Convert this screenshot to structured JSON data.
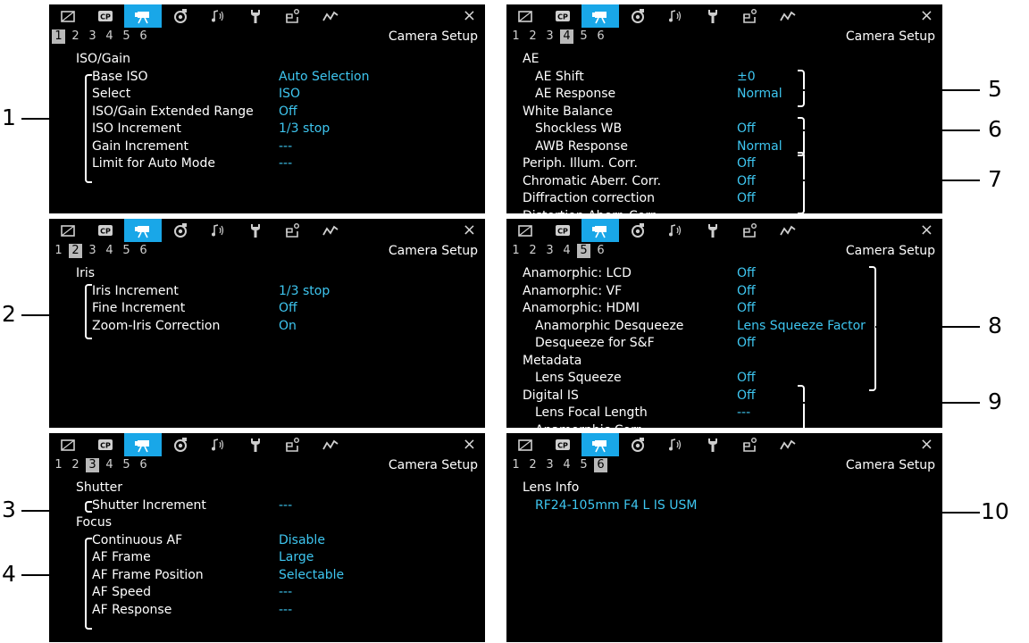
{
  "tabs": [
    {
      "icon": "screen-icon"
    },
    {
      "icon": "cp-icon"
    },
    {
      "icon": "camera-icon"
    },
    {
      "icon": "aperture-icon"
    },
    {
      "icon": "audio-icon"
    },
    {
      "icon": "wrench-icon"
    },
    {
      "icon": "assist-icon"
    },
    {
      "icon": "waveform-icon"
    }
  ],
  "close_glyph": "×",
  "panel_title": "Camera Setup",
  "page_numbers": [
    "1",
    "2",
    "3",
    "4",
    "5",
    "6"
  ],
  "panels": [
    {
      "active_page": 0,
      "rows": [
        {
          "label": "ISO/Gain",
          "value": "",
          "indent": 0
        },
        {
          "label": "Base ISO",
          "value": "Auto Selection",
          "indent": 1
        },
        {
          "label": "Select",
          "value": "ISO",
          "indent": 1
        },
        {
          "label": "ISO/Gain Extended Range",
          "value": "Off",
          "indent": 1
        },
        {
          "label": "ISO Increment",
          "value": "1/3 stop",
          "indent": 1
        },
        {
          "label": "Gain Increment",
          "value": "---",
          "indent": 1
        },
        {
          "label": "Limit for Auto Mode",
          "value": "---",
          "indent": 1
        }
      ]
    },
    {
      "active_page": 3,
      "rows": [
        {
          "label": "AE",
          "value": "",
          "indent": 0
        },
        {
          "label": "AE Shift",
          "value": "±0",
          "indent": 1
        },
        {
          "label": "AE Response",
          "value": "Normal",
          "indent": 1
        },
        {
          "label": "White Balance",
          "value": "",
          "indent": 0
        },
        {
          "label": "Shockless WB",
          "value": "Off",
          "indent": 1
        },
        {
          "label": "AWB Response",
          "value": "Normal",
          "indent": 1
        },
        {
          "label": "Periph. Illum. Corr.",
          "value": "Off",
          "indent": 0
        },
        {
          "label": "Chromatic Aberr. Corr.",
          "value": "Off",
          "indent": 0
        },
        {
          "label": "Diffraction correction",
          "value": "Off",
          "indent": 0
        },
        {
          "label": "Distortion Aberr. Corr.",
          "value": "---",
          "indent": 0
        }
      ]
    },
    {
      "active_page": 1,
      "rows": [
        {
          "label": "Iris",
          "value": "",
          "indent": 0
        },
        {
          "label": "Iris Increment",
          "value": "1/3 stop",
          "indent": 1
        },
        {
          "label": "Fine Increment",
          "value": "Off",
          "indent": 1
        },
        {
          "label": "Zoom-Iris Correction",
          "value": "On",
          "indent": 1
        }
      ]
    },
    {
      "active_page": 4,
      "rows": [
        {
          "label": "Anamorphic: LCD",
          "value": "Off",
          "indent": 0
        },
        {
          "label": "Anamorphic: VF",
          "value": "Off",
          "indent": 0
        },
        {
          "label": "Anamorphic: HDMI",
          "value": "Off",
          "indent": 0
        },
        {
          "label": "Anamorphic Desqueeze",
          "value": "Lens Squeeze Factor",
          "indent": 1
        },
        {
          "label": "Desqueeze for S&F",
          "value": "Off",
          "indent": 1
        },
        {
          "label": "Metadata",
          "value": "",
          "indent": 0
        },
        {
          "label": "Lens Squeeze",
          "value": "Off",
          "indent": 1
        },
        {
          "label": "Digital IS",
          "value": "Off",
          "indent": 0
        },
        {
          "label": "Lens Focal Length",
          "value": "---",
          "indent": 1
        },
        {
          "label": "Anamorphic Corr.",
          "value": "---",
          "indent": 1
        }
      ]
    },
    {
      "active_page": 2,
      "rows": [
        {
          "label": "Shutter",
          "value": "",
          "indent": 0
        },
        {
          "label": "Shutter Increment",
          "value": "---",
          "indent": 1
        },
        {
          "label": "Focus",
          "value": "",
          "indent": 0
        },
        {
          "label": "Continuous AF",
          "value": "Disable",
          "indent": 1
        },
        {
          "label": "AF Frame",
          "value": "Large",
          "indent": 1
        },
        {
          "label": "AF Frame Position",
          "value": "Selectable",
          "indent": 1
        },
        {
          "label": "AF Speed",
          "value": "---",
          "indent": 1
        },
        {
          "label": "AF Response",
          "value": "---",
          "indent": 1
        }
      ]
    },
    {
      "active_page": 5,
      "rows": [
        {
          "label": "Lens Info",
          "value": "",
          "indent": 0
        },
        {
          "label": "",
          "value": "RF24-105mm F4 L IS USM",
          "indent": 1
        }
      ]
    }
  ],
  "callouts": [
    "1",
    "2",
    "3",
    "4",
    "5",
    "6",
    "7",
    "8",
    "9",
    "10"
  ],
  "colors": {
    "accent_tab": "#19a7e8",
    "value_text": "#3ec6f0",
    "active_page_bg": "#b9b9b9"
  }
}
